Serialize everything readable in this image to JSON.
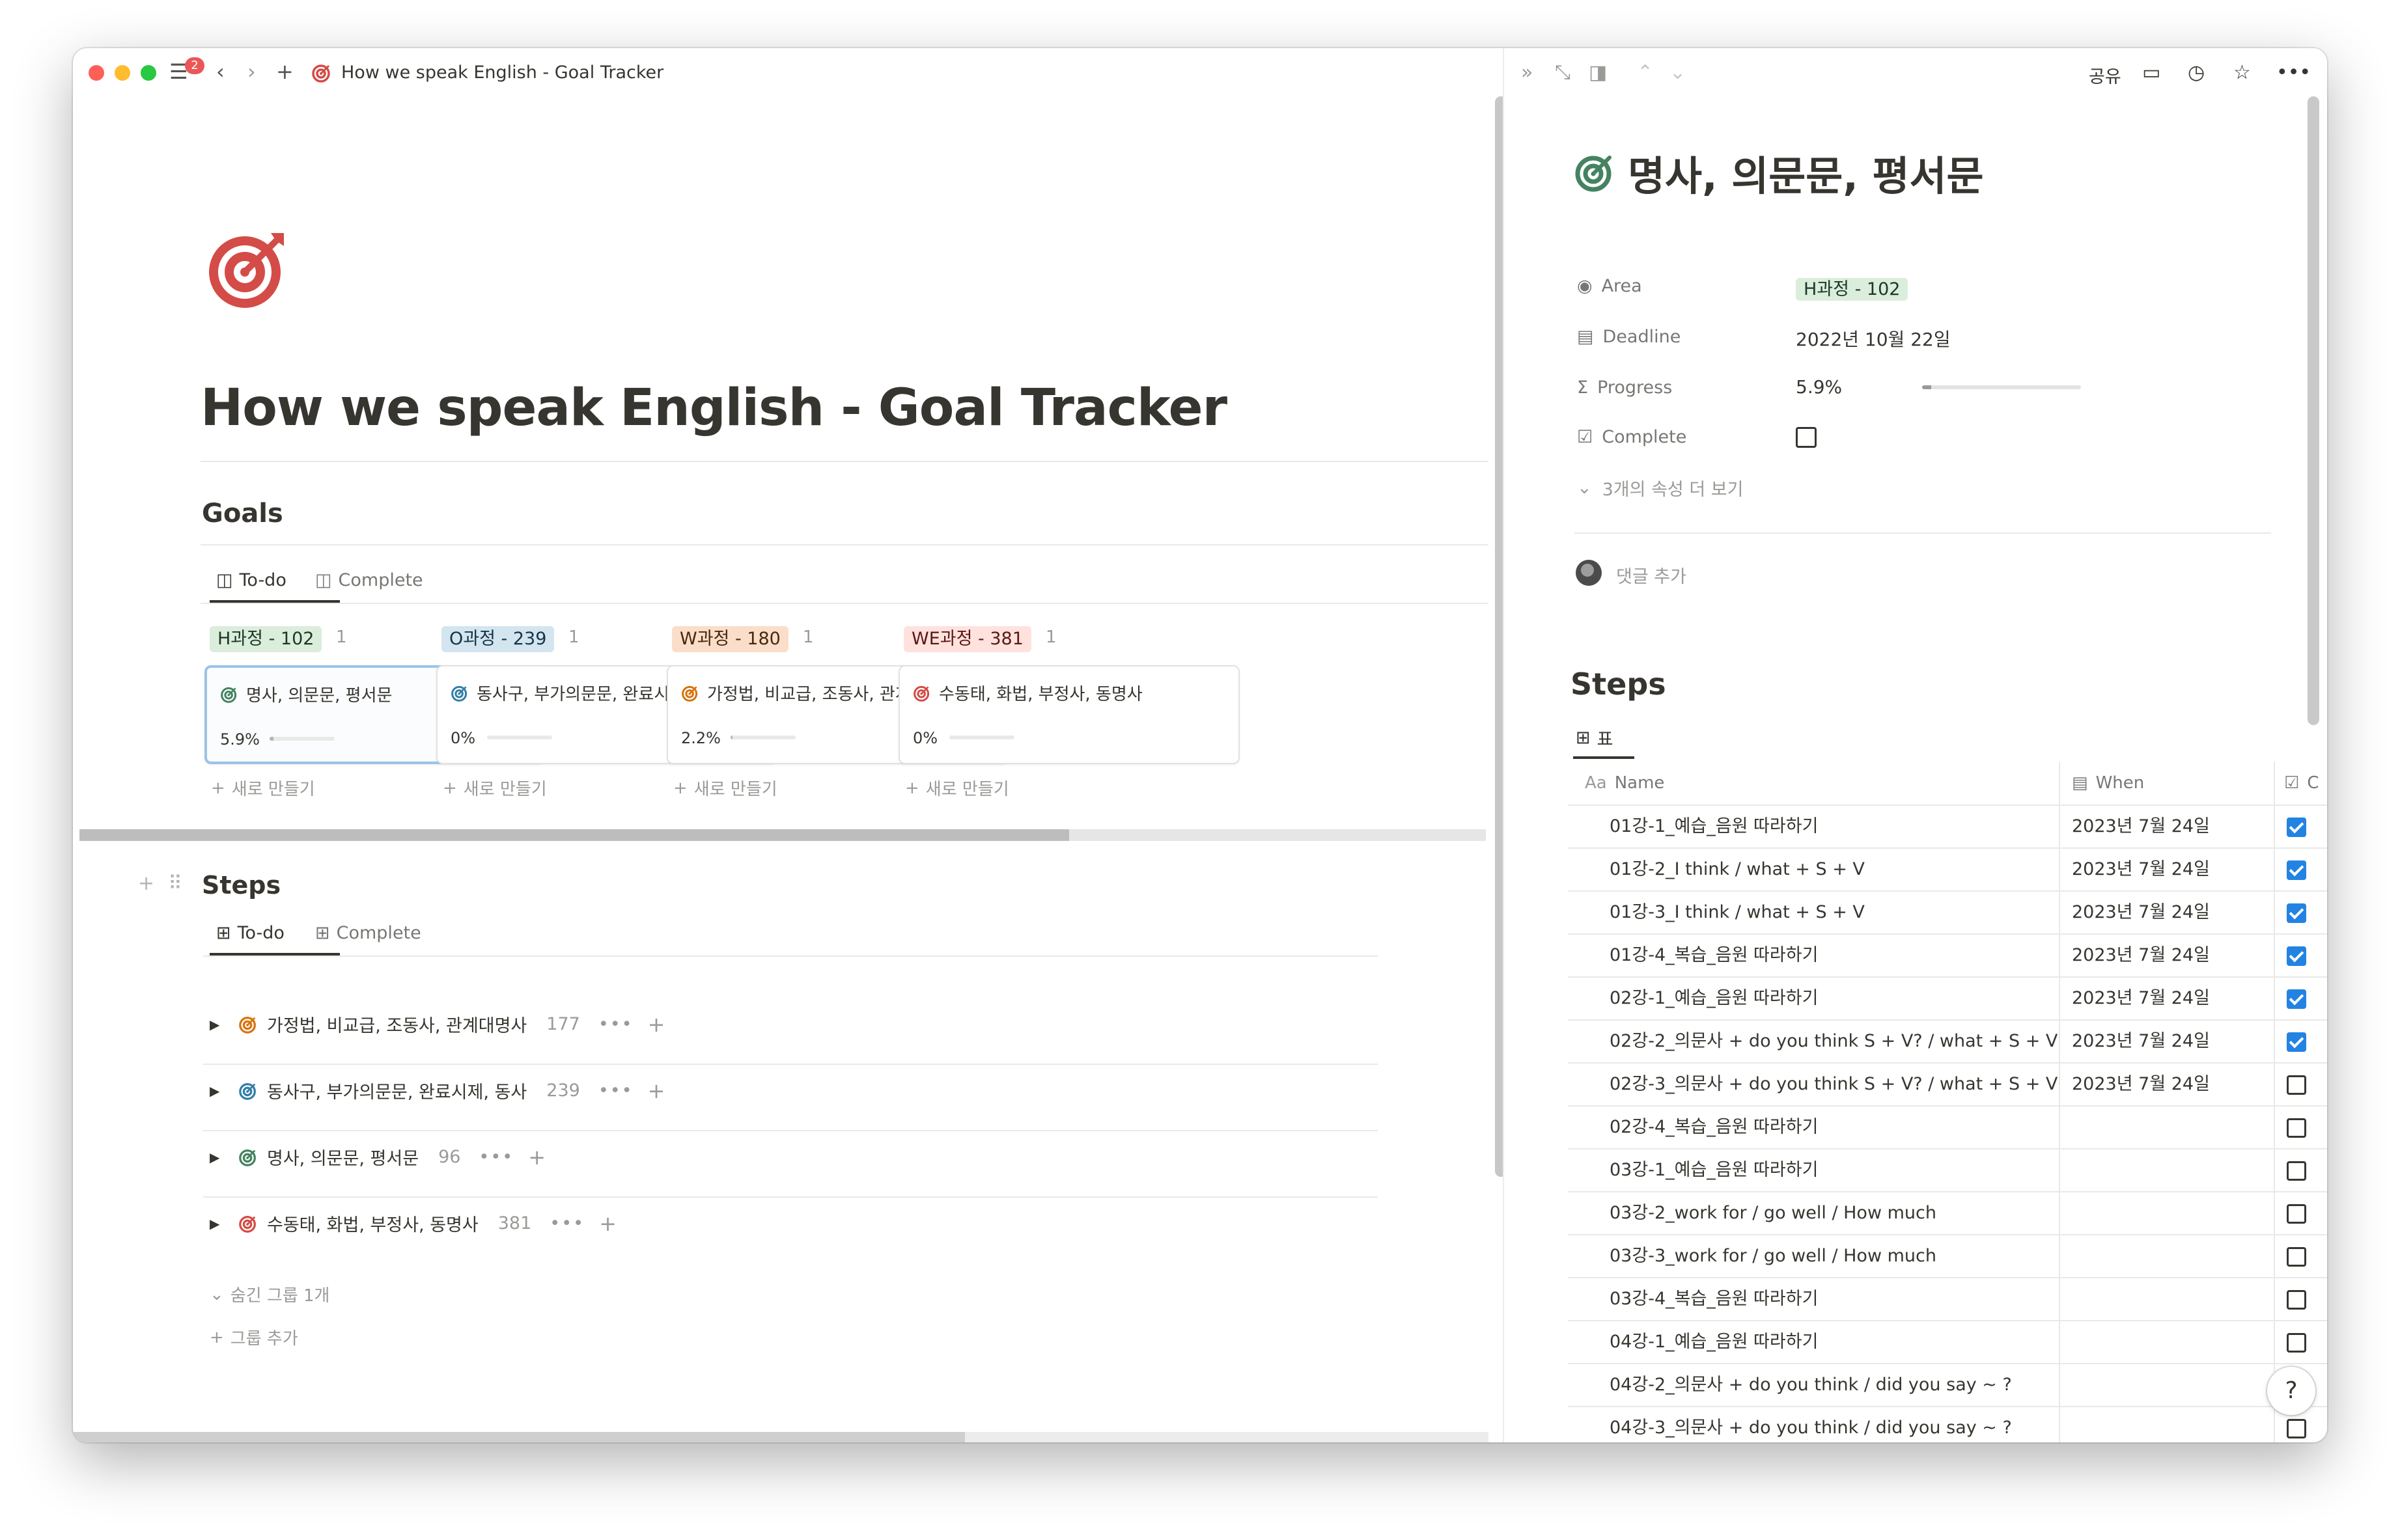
{
  "window": {
    "notification_count": "2",
    "breadcrumb_title": "How we speak English - Goal Tracker"
  },
  "page": {
    "title": "How we speak English - Goal Tracker",
    "goals": {
      "heading": "Goals",
      "tabs": [
        "To-do",
        "Complete"
      ],
      "new_label": "새로 만들기",
      "groups": [
        {
          "tag": "H과정 - 102",
          "count": "1",
          "tag_bg": "#dbeddb",
          "tag_fg": "#1c3829",
          "card": {
            "title": "명사, 의문문, 평서문",
            "percent": "5.9%",
            "progress": 0.059,
            "icon_color": "#448361"
          }
        },
        {
          "tag": "O과정 - 239",
          "count": "1",
          "tag_bg": "#d3e5ef",
          "tag_fg": "#183347",
          "card": {
            "title": "동사구, 부가의문문, 완료시제, 동사",
            "percent": "0%",
            "progress": 0,
            "icon_color": "#337ea9"
          }
        },
        {
          "tag": "W과정 - 180",
          "count": "1",
          "tag_bg": "#fadec9",
          "tag_fg": "#49290e",
          "card": {
            "title": "가정법, 비교급, 조동사, 관계대명사",
            "percent": "2.2%",
            "progress": 0.022,
            "icon_color": "#d9730d"
          }
        },
        {
          "tag": "WE과정 - 381",
          "count": "1",
          "tag_bg": "#ffe2dd",
          "tag_fg": "#5d1715",
          "card": {
            "title": "수동태, 화법, 부정사, 동명사",
            "percent": "0%",
            "progress": 0,
            "icon_color": "#d44c47"
          }
        }
      ]
    },
    "steps": {
      "heading": "Steps",
      "tabs": [
        "To-do",
        "Complete"
      ],
      "groups": [
        {
          "title": "가정법, 비교급, 조동사, 관계대명사",
          "count": "177",
          "icon_color": "#d9730d"
        },
        {
          "title": "동사구, 부가의문문, 완료시제, 동사",
          "count": "239",
          "icon_color": "#337ea9"
        },
        {
          "title": "명사, 의문문, 평서문",
          "count": "96",
          "icon_color": "#448361"
        },
        {
          "title": "수동태, 화법, 부정사, 동명사",
          "count": "381",
          "icon_color": "#d44c47"
        }
      ],
      "hidden_groups": "숨긴 그룹 1개",
      "add_group": "그룹 추가"
    }
  },
  "side_peek": {
    "share": "공유",
    "title": "명사, 의문문, 평서문",
    "properties": {
      "area_label": "Area",
      "area_value": "H과정 - 102",
      "deadline_label": "Deadline",
      "deadline_value": "2022년 10월 22일",
      "progress_label": "Progress",
      "progress_value": "5.9%",
      "progress": 0.059,
      "complete_label": "Complete",
      "more": "3개의 속성 더 보기"
    },
    "comment_placeholder": "댓글 추가",
    "steps_heading": "Steps",
    "table_tab": "표",
    "columns": {
      "name": "Name",
      "when": "When",
      "check": "C"
    },
    "rows": [
      {
        "name": "01강-1_예습_음원 따라하기",
        "when": "2023년 7월 24일",
        "done": true
      },
      {
        "name": "01강-2_I think / what + S + V",
        "when": "2023년 7월 24일",
        "done": true
      },
      {
        "name": "01강-3_I think / what + S + V",
        "when": "2023년 7월 24일",
        "done": true
      },
      {
        "name": "01강-4_복습_음원 따라하기",
        "when": "2023년 7월 24일",
        "done": true
      },
      {
        "name": "02강-1_예습_음원 따라하기",
        "when": "2023년 7월 24일",
        "done": true
      },
      {
        "name": "02강-2_의문사 + do you think S + V? / what + S + V",
        "when": "2023년 7월 24일",
        "done": true
      },
      {
        "name": "02강-3_의문사 + do you think S + V? / what + S + V",
        "when": "2023년 7월 24일",
        "done": false
      },
      {
        "name": "02강-4_복습_음원 따라하기",
        "when": "",
        "done": false
      },
      {
        "name": "03강-1_예습_음원 따라하기",
        "when": "",
        "done": false
      },
      {
        "name": "03강-2_work for / go well / How much",
        "when": "",
        "done": false
      },
      {
        "name": "03강-3_work for / go well / How much",
        "when": "",
        "done": false
      },
      {
        "name": "03강-4_복습_음원 따라하기",
        "when": "",
        "done": false
      },
      {
        "name": "04강-1_예습_음원 따라하기",
        "when": "",
        "done": false
      },
      {
        "name": "04강-2_의문사 + do you think / did you say ~ ?",
        "when": "",
        "done": false
      },
      {
        "name": "04강-3_의문사 + do you think / did you say ~ ?",
        "when": "",
        "done": false
      }
    ],
    "help": "?"
  }
}
